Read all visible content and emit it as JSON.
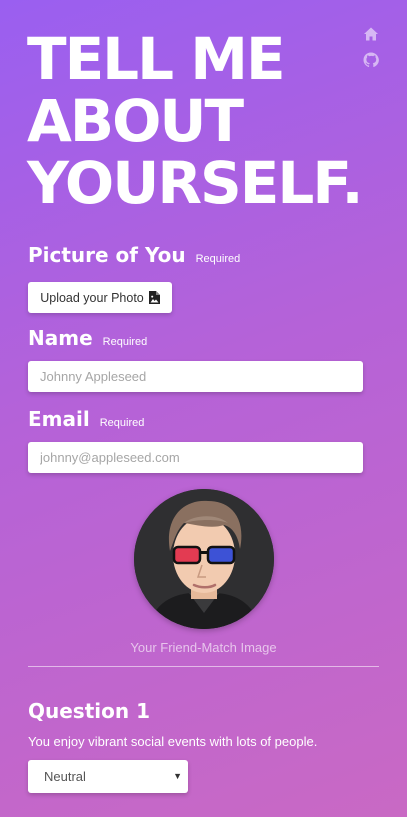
{
  "header": {
    "title_lines": [
      "TELL ME",
      "ABOUT",
      "YOURSELF."
    ],
    "icons": [
      "home-icon",
      "github-icon"
    ]
  },
  "photo": {
    "label": "Picture of You",
    "required": "Required",
    "button_label": "Upload your Photo",
    "button_icon": "file-image-icon"
  },
  "name": {
    "label": "Name",
    "required": "Required",
    "placeholder": "Johnny Appleseed",
    "value": ""
  },
  "email": {
    "label": "Email",
    "required": "Required",
    "placeholder": "johnny@appleseed.com",
    "value": ""
  },
  "match_image": {
    "caption": "Your Friend-Match Image"
  },
  "question1": {
    "title": "Question 1",
    "text": "You enjoy vibrant social events with lots of people.",
    "selected": "Neutral"
  },
  "colors": {
    "gradient_start": "#9a5ff0",
    "gradient_end": "#c969c4",
    "text": "#ffffff"
  }
}
